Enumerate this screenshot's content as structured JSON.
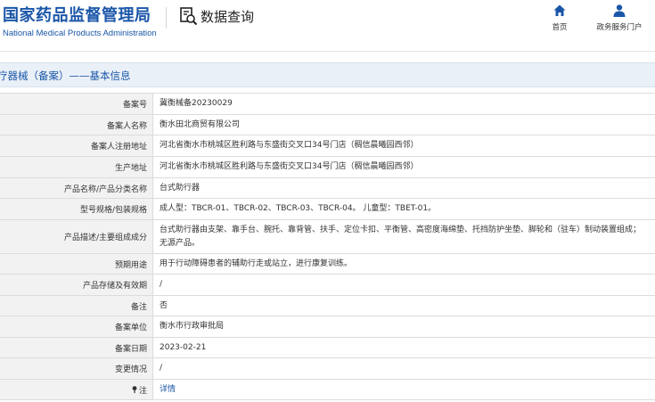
{
  "header": {
    "title_cn": "国家药品监督管理局",
    "title_en": "National Medical Products Administration",
    "query_label": "数据查询",
    "nav": [
      {
        "label": "首页",
        "icon": "home-icon"
      },
      {
        "label": "政务服务门户",
        "icon": "person-icon"
      }
    ]
  },
  "section": {
    "title": "疗器械（备案）——基本信息"
  },
  "table": {
    "rows": [
      {
        "label": "备案号",
        "value": "冀衡械备20230029"
      },
      {
        "label": "备案人名称",
        "value": "衡水田北商贸有限公司"
      },
      {
        "label": "备案人注册地址",
        "value": "河北省衡水市桃城区胜利路与东盛街交叉口34号门店（稠信晨曦园西邻）"
      },
      {
        "label": "生产地址",
        "value": "河北省衡水市桃城区胜利路与东盛街交叉口34号门店（稠信晨曦园西邻）"
      },
      {
        "label": "产品名称/产品分类名称",
        "value": "台式助行器"
      },
      {
        "label": "型号规格/包装规格",
        "value": "成人型：TBCR-01、TBCR-02、TBCR-03、TBCR-04。 儿童型：TBET-01。"
      },
      {
        "label": "产品描述/主要组成成分",
        "value": "台式助行器由支架、靠手台、腕托、靠背管、扶手、定位卡扣、平衡管、高密度海绵垫、托挡防护坐垫、脚轮和（驻车）制动装置组成；无源产品。"
      },
      {
        "label": "预期用途",
        "value": "用于行动障碍患者的辅助行走或站立，进行康复训练。"
      },
      {
        "label": "产品存储及有效期",
        "value": "/"
      },
      {
        "label": "备注",
        "value": "否"
      },
      {
        "label": "备案单位",
        "value": "衡水市行政审批局"
      },
      {
        "label": "备案日期",
        "value": "2023-02-21"
      },
      {
        "label": "变更情况",
        "value": "/"
      },
      {
        "label": "注",
        "value": "详情"
      }
    ]
  },
  "colors": {
    "brand": "#1a56a8",
    "label_bg": "#f2f2f2",
    "section_bg": "#eaf0f7",
    "border": "#dcdcdc"
  }
}
